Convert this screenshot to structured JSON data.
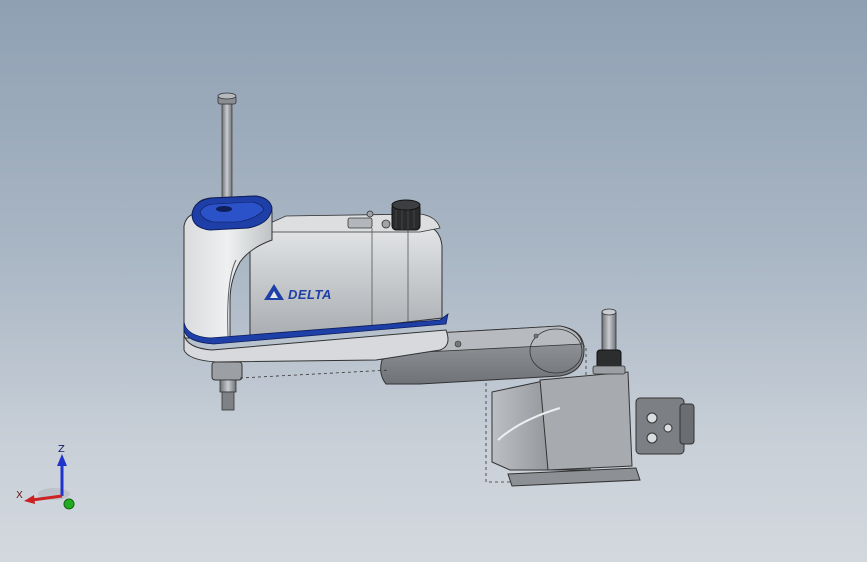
{
  "viewport": {
    "background_top": "#8fa0b3",
    "background_bottom": "#d3d8de"
  },
  "model": {
    "brand": "DELTA",
    "body_color": "#c9ccd0",
    "accent_color": "#1f3fa8",
    "arm_color": "#8f9296"
  },
  "triad": {
    "x_label": "X",
    "y_label": "",
    "z_label": "Z",
    "x_color": "#cc2222",
    "z_color": "#2233cc",
    "y_color": "#22aa22"
  }
}
